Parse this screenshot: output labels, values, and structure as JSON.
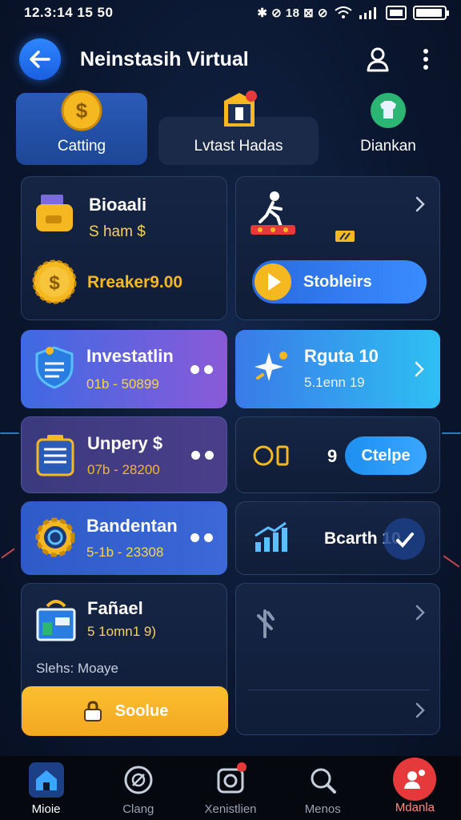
{
  "status_bar": {
    "time": "12.3:14 15 50",
    "icons": "✱ ⊘ 18 ⊠ ⊘",
    "battery_level": 0.95
  },
  "header": {
    "title": "Neinstasih Virtual",
    "back_icon": "arrow-left-icon",
    "profile_icon": "user-icon",
    "menu_icon": "more-vertical-icon"
  },
  "tabs": [
    {
      "label": "Catting",
      "icon": "coin-icon",
      "active": true
    },
    {
      "label": "Lvtast Hadas",
      "icon": "shop-badge-icon",
      "active": false
    },
    {
      "label": "Diankan",
      "icon": "shirt-icon",
      "active": false
    }
  ],
  "cards": {
    "balance": {
      "title": "Bioaali",
      "subtitle": "S ham $",
      "breaker": "Rreaker9.00"
    },
    "promo": {
      "button_label": "Stobleirs"
    },
    "investatlin": {
      "title": "Investatlin",
      "subtitle": "01b - 50899"
    },
    "rguta": {
      "title": "Rguta 10",
      "subtitle": "5.1enn 19"
    },
    "unpery": {
      "title": "Unpery $",
      "subtitle": "07b - 28200"
    },
    "ctelpe": {
      "count": "9",
      "button_label": "Ctelpe"
    },
    "bandentan": {
      "title": "Bandentan",
      "subtitle": "5-1b - 23308"
    },
    "bcarth": {
      "label": "Bcarth 10"
    },
    "fafael": {
      "title": "Fañael",
      "subtitle": "5 1omn1 9)",
      "note": "Slehs: Moaye",
      "button_label": "Soolue"
    }
  },
  "bottom_nav": [
    {
      "label": "Mioie",
      "icon": "home-icon",
      "active": true
    },
    {
      "label": "Clang",
      "icon": "search-circle-icon",
      "active": false
    },
    {
      "label": "Xenistlien",
      "icon": "camera-icon",
      "active": false
    },
    {
      "label": "Menos",
      "icon": "search-icon",
      "active": false
    },
    {
      "label": "Mdanla",
      "icon": "profile-badge-icon",
      "active": false
    }
  ],
  "colors": {
    "accent_blue": "#2d86ff",
    "accent_yellow": "#f5b820",
    "accent_purple": "#7f56d9",
    "accent_cyan": "#2ab8f0",
    "alert_red": "#e5393b"
  }
}
